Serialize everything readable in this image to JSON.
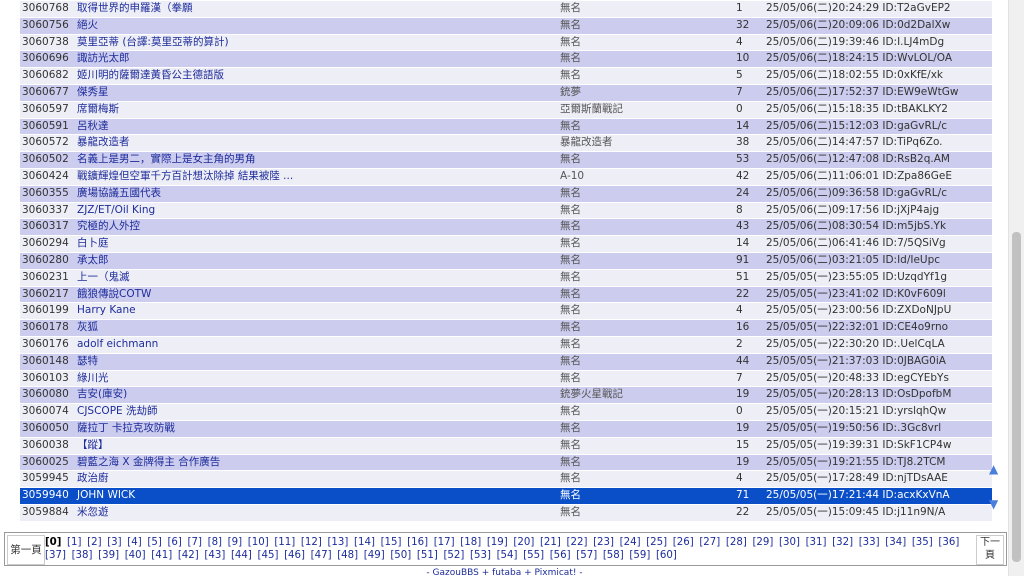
{
  "threads": [
    {
      "no": "3060768",
      "title": "取得世界的申羅漢（拳願",
      "author": "無名",
      "replies": "1",
      "date": "25/05/06(二)20:24:29 ID:T2aGvEP2"
    },
    {
      "no": "3060756",
      "title": "絕火",
      "author": "無名",
      "replies": "32",
      "date": "25/05/06(二)20:09:06 ID:0d2DalXw"
    },
    {
      "no": "3060738",
      "title": "莫里亞蒂 (台譯:莫里亞蒂的算計)",
      "author": "無名",
      "replies": "4",
      "date": "25/05/06(二)19:39:46 ID:I.LJ4mDg"
    },
    {
      "no": "3060696",
      "title": "諏訪光太郎",
      "author": "無名",
      "replies": "10",
      "date": "25/05/06(二)18:24:15 ID:WvLOL/OA"
    },
    {
      "no": "3060682",
      "title": "姬川明的薩爾達黃昏公主德語版",
      "author": "無名",
      "replies": "5",
      "date": "25/05/06(二)18:02:55 ID:0xKfE/xk"
    },
    {
      "no": "3060677",
      "title": "傑秀星",
      "author": "銃夢",
      "replies": "7",
      "date": "25/05/06(二)17:52:37 ID:EW9eWtGw"
    },
    {
      "no": "3060597",
      "title": "席爾梅斯",
      "author": "亞爾斯蘭戰記",
      "replies": "0",
      "date": "25/05/06(二)15:18:35 ID:tBAKLKY2"
    },
    {
      "no": "3060591",
      "title": "呂秋達",
      "author": "無名",
      "replies": "14",
      "date": "25/05/06(二)15:12:03 ID:gaGvRL/c"
    },
    {
      "no": "3060572",
      "title": "暴龍改造者",
      "author": "暴龍改造者",
      "replies": "38",
      "date": "25/05/06(二)14:47:57 ID:TiPq6Zo."
    },
    {
      "no": "3060502",
      "title": "名義上是男二，實際上是女主角的男角",
      "author": "無名",
      "replies": "53",
      "date": "25/05/06(二)12:47:08 ID:RsB2q.AM"
    },
    {
      "no": "3060424",
      "title": "戰鑛輝煌但空軍千方百計想汰除掉 結果被陸 ...",
      "author": "A-10",
      "replies": "42",
      "date": "25/05/06(二)11:06:01 ID:Zpa86GeE"
    },
    {
      "no": "3060355",
      "title": "廣場協議五國代表",
      "author": "無名",
      "replies": "24",
      "date": "25/05/06(二)09:36:58 ID:gaGvRL/c"
    },
    {
      "no": "3060337",
      "title": "ZJZ/ET/Oil King",
      "author": "無名",
      "replies": "8",
      "date": "25/05/06(二)09:17:56 ID:jXjP4ajg"
    },
    {
      "no": "3060317",
      "title": "究極的人外控",
      "author": "無名",
      "replies": "43",
      "date": "25/05/06(二)08:30:54 ID:m5jbS.Yk"
    },
    {
      "no": "3060294",
      "title": "白卜庭",
      "author": "無名",
      "replies": "14",
      "date": "25/05/06(二)06:41:46 ID:7/5QSiVg"
    },
    {
      "no": "3060280",
      "title": "承太郎",
      "author": "無名",
      "replies": "91",
      "date": "25/05/06(二)03:21:05 ID:Id/IeUpc"
    },
    {
      "no": "3060231",
      "title": "上一（鬼滅",
      "author": "無名",
      "replies": "51",
      "date": "25/05/05(一)23:55:05 ID:UzqdYf1g"
    },
    {
      "no": "3060217",
      "title": "餓狼傳說COTW",
      "author": "無名",
      "replies": "22",
      "date": "25/05/05(一)23:41:02 ID:K0vF609l"
    },
    {
      "no": "3060199",
      "title": "Harry Kane",
      "author": "無名",
      "replies": "4",
      "date": "25/05/05(一)23:00:56 ID:ZXDoNJpU"
    },
    {
      "no": "3060178",
      "title": "灰狐",
      "author": "無名",
      "replies": "16",
      "date": "25/05/05(一)22:32:01 ID:CE4o9rno"
    },
    {
      "no": "3060176",
      "title": "adolf eichmann",
      "author": "無名",
      "replies": "2",
      "date": "25/05/05(一)22:30:20 ID:.UelCqLA"
    },
    {
      "no": "3060148",
      "title": "瑟特",
      "author": "無名",
      "replies": "44",
      "date": "25/05/05(一)21:37:03 ID:0JBAG0iA"
    },
    {
      "no": "3060103",
      "title": "綠川光",
      "author": "無名",
      "replies": "7",
      "date": "25/05/05(一)20:48:33 ID:egCYEbYs"
    },
    {
      "no": "3060080",
      "title": "吉安(庫安)",
      "author": "銃夢火星戰記",
      "replies": "19",
      "date": "25/05/05(一)20:28:13 ID:OsDpofbM"
    },
    {
      "no": "3060074",
      "title": "CJSCOPE 洗劫師",
      "author": "無名",
      "replies": "0",
      "date": "25/05/05(一)20:15:21 ID:yrslqhQw"
    },
    {
      "no": "3060050",
      "title": "薩拉丁 卡拉克攻防戰",
      "author": "無名",
      "replies": "19",
      "date": "25/05/05(一)19:50:56 ID:.3Gc8vrl"
    },
    {
      "no": "3060038",
      "title": "【蹤】",
      "author": "無名",
      "replies": "15",
      "date": "25/05/05(一)19:39:31 ID:SkF1CP4w"
    },
    {
      "no": "3060025",
      "title": "碧藍之海 X 金牌得主 合作廣告",
      "author": "無名",
      "replies": "19",
      "date": "25/05/05(一)19:21:55 ID:TJ8.2TCM"
    },
    {
      "no": "3059945",
      "title": "政治廚",
      "author": "無名",
      "replies": "4",
      "date": "25/05/05(一)17:28:49 ID:njTDsAAE"
    },
    {
      "no": "3059940",
      "title": "JOHN WICK",
      "author": "無名",
      "replies": "71",
      "date": "25/05/05(一)17:21:44 ID:acxKxVnA",
      "selected": true
    },
    {
      "no": "3059884",
      "title": "米忽遊",
      "author": "無名",
      "replies": "22",
      "date": "25/05/05(一)15:09:45 ID:j11n9N/A"
    }
  ],
  "pager": {
    "first_label": "第一頁",
    "next_label": "下一頁",
    "current": "[0]",
    "pages": [
      "[1]",
      "[2]",
      "[3]",
      "[4]",
      "[5]",
      "[6]",
      "[7]",
      "[8]",
      "[9]",
      "[10]",
      "[11]",
      "[12]",
      "[13]",
      "[14]",
      "[15]",
      "[16]",
      "[17]",
      "[18]",
      "[19]",
      "[20]",
      "[21]",
      "[22]",
      "[23]",
      "[24]",
      "[25]",
      "[26]",
      "[27]",
      "[28]",
      "[29]",
      "[30]",
      "[31]",
      "[32]",
      "[33]",
      "[34]",
      "[35]",
      "[36]",
      "[37]",
      "[38]",
      "[39]",
      "[40]",
      "[41]",
      "[42]",
      "[43]",
      "[44]",
      "[45]",
      "[46]",
      "[47]",
      "[48]",
      "[49]",
      "[50]",
      "[51]",
      "[52]",
      "[53]",
      "[54]",
      "[55]",
      "[56]",
      "[57]",
      "[58]",
      "[59]",
      "[60]"
    ]
  },
  "footer": {
    "text": "- GazouBBS + futaba + Pixmicat! -"
  },
  "icons": {
    "up": "▲",
    "down": "▼"
  }
}
